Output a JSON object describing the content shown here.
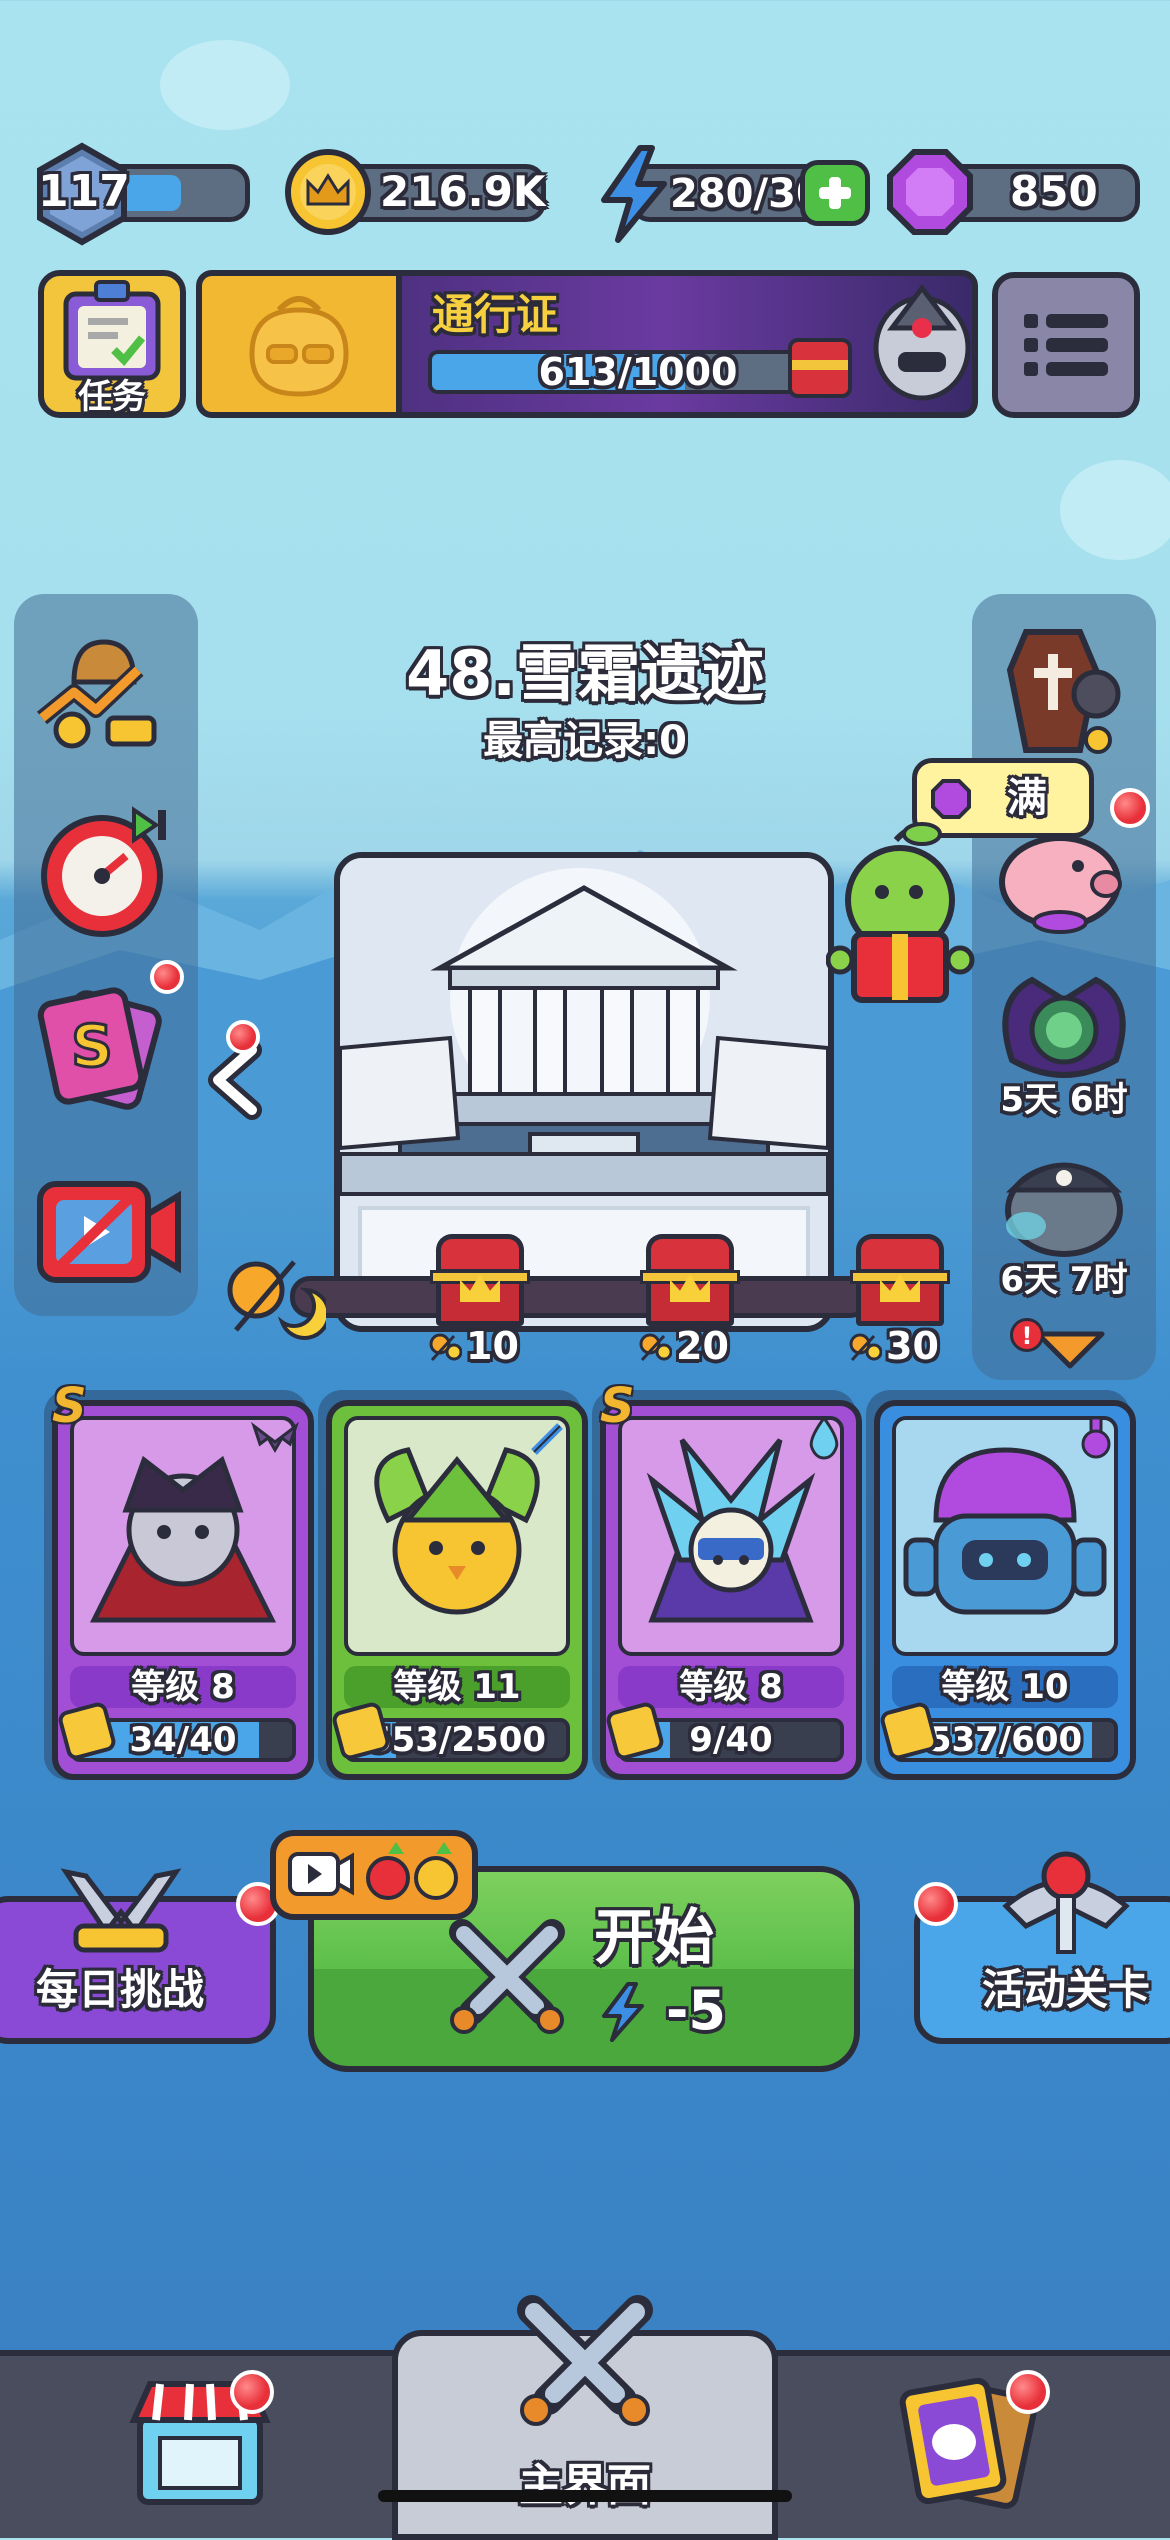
{
  "top_bar": {
    "level": "117",
    "level_progress": 0.6,
    "coins": "216.9K",
    "energy": "280/30",
    "gems": "850"
  },
  "task": {
    "label": "任务"
  },
  "pass": {
    "title": "通行证",
    "progress_text": "613/1000",
    "progress": 0.613
  },
  "stage": {
    "title": "48.雪霜遗迹",
    "best_record": "最高记录:0"
  },
  "piggy": {
    "bubble": "满"
  },
  "events": [
    {
      "time": "5天 6时",
      "color": "#6b3aa8"
    },
    {
      "time": "6天 7时",
      "color": "#4d5a66"
    }
  ],
  "milestones": [
    {
      "value": "10"
    },
    {
      "value": "20"
    },
    {
      "value": "30"
    }
  ],
  "cards": [
    {
      "rank": "S",
      "level": "等级 8",
      "progress_text": "34/40",
      "progress": 0.85,
      "theme": "purple",
      "icon": "bat-icon"
    },
    {
      "rank": "",
      "level": "等级 11",
      "progress_text": "553/2500",
      "progress": 0.22,
      "theme": "green",
      "icon": "sword-icon"
    },
    {
      "rank": "S",
      "level": "等级 8",
      "progress_text": "9/40",
      "progress": 0.22,
      "theme": "purple",
      "icon": "water-drop-icon"
    },
    {
      "rank": "",
      "level": "等级 10",
      "progress_text": "537/600",
      "progress": 0.9,
      "theme": "blue",
      "icon": "potion-icon"
    }
  ],
  "buttons": {
    "daily_challenge": "每日挑战",
    "start": "开始",
    "start_cost": "-5",
    "event_stage": "活动关卡"
  },
  "nav": {
    "main": "主界面"
  },
  "colors": {
    "green_button": "#5cbf4a",
    "purple_card": "#a24fd6",
    "green_card": "#6cc03c",
    "blue_card": "#3a8ee0"
  }
}
